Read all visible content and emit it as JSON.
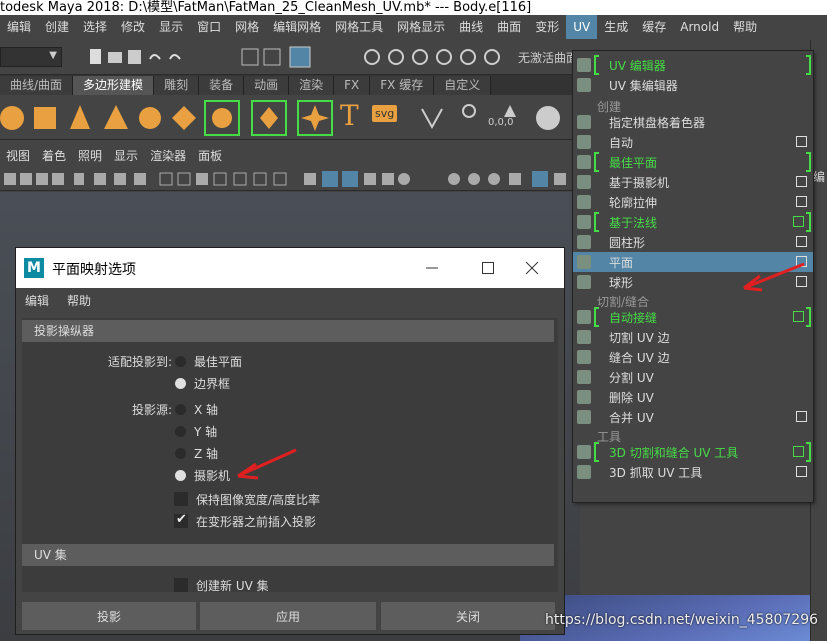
{
  "window": {
    "title": "todesk Maya 2018: D:\\模型\\FatMan\\FatMan_25_CleanMesh_UV.mb*   ---   Body.e[116]"
  },
  "menubar": [
    "编辑",
    "创建",
    "选择",
    "修改",
    "显示",
    "窗口",
    "网格",
    "编辑网格",
    "网格工具",
    "网格显示",
    "曲线",
    "曲面",
    "变形",
    "UV",
    "生成",
    "缓存",
    "Arnold",
    "帮助"
  ],
  "menubar_active": "UV",
  "statusline": {
    "field_placeholder": "无激活曲面"
  },
  "shelf_tabs": [
    "曲线/曲面",
    "多边形建模",
    "雕刻",
    "装备",
    "动画",
    "渲染",
    "FX",
    "FX 缓存",
    "自定义"
  ],
  "shelf_active": "多边形建模",
  "shelf_text_icons": {
    "t": "T",
    "svg": "svg",
    "coords": "0,0,0"
  },
  "panel_menu": [
    "视图",
    "着色",
    "照明",
    "显示",
    "渲染器",
    "面板"
  ],
  "dialog": {
    "title": "平面映射选项",
    "logo": "M",
    "menu": [
      "编辑",
      "帮助"
    ],
    "section1": "投影操纵器",
    "fit_label": "适配投影到:",
    "fit_options": [
      "最佳平面",
      "边界框"
    ],
    "fit_selected": 1,
    "source_label": "投影源:",
    "source_options": [
      "X 轴",
      "Y 轴",
      "Z 轴",
      "摄影机"
    ],
    "source_selected": 3,
    "keep_ratio": "保持图像宽度/高度比率",
    "keep_ratio_checked": false,
    "insert_before": "在变形器之前插入投影",
    "insert_before_checked": true,
    "section2": "UV 集",
    "create_uv_set": "创建新 UV 集",
    "create_uv_set_checked": false,
    "buttons": [
      "投影",
      "应用",
      "关闭"
    ]
  },
  "uv_menu": {
    "items": [
      {
        "label": "UV 编辑器",
        "green": true,
        "bracket": true,
        "option": false
      },
      {
        "label": "UV 集编辑器",
        "green": false,
        "bracket": false,
        "option": false
      },
      {
        "section": "创建"
      },
      {
        "label": "指定棋盘格着色器",
        "green": false,
        "bracket": false,
        "option": false
      },
      {
        "label": "自动",
        "green": false,
        "bracket": false,
        "option": true
      },
      {
        "label": "最佳平面",
        "green": true,
        "bracket": true,
        "option": false
      },
      {
        "label": "基于摄影机",
        "green": false,
        "bracket": false,
        "option": true
      },
      {
        "label": "轮廓拉伸",
        "green": false,
        "bracket": false,
        "option": true
      },
      {
        "label": "基于法线",
        "green": true,
        "bracket": true,
        "option": true
      },
      {
        "label": "圆柱形",
        "green": false,
        "bracket": false,
        "option": true
      },
      {
        "label": "平面",
        "green": false,
        "bracket": false,
        "option": true,
        "highlight": true
      },
      {
        "label": "球形",
        "green": false,
        "bracket": false,
        "option": true
      },
      {
        "section": "切割/缝合"
      },
      {
        "label": "自动接缝",
        "green": true,
        "bracket": true,
        "option": true
      },
      {
        "label": "切割 UV 边",
        "green": false,
        "bracket": false,
        "option": false
      },
      {
        "label": "缝合 UV 边",
        "green": false,
        "bracket": false,
        "option": false
      },
      {
        "label": "分割 UV",
        "green": false,
        "bracket": false,
        "option": false
      },
      {
        "label": "删除 UV",
        "green": false,
        "bracket": false,
        "option": false
      },
      {
        "label": "合并 UV",
        "green": false,
        "bracket": false,
        "option": true
      },
      {
        "section": "工具"
      },
      {
        "label": "3D 切割和缝合 UV 工具",
        "green": true,
        "bracket": true,
        "option": true
      },
      {
        "label": "3D 抓取 UV 工具",
        "green": false,
        "bracket": false,
        "option": true
      }
    ]
  },
  "side_text": "编",
  "watermark": "https://blog.csdn.net/weixin_45807296",
  "colors": {
    "accent": "#5285a6",
    "green": "#46dc46",
    "arrow": "#e02020",
    "orange": "#e8a040"
  }
}
